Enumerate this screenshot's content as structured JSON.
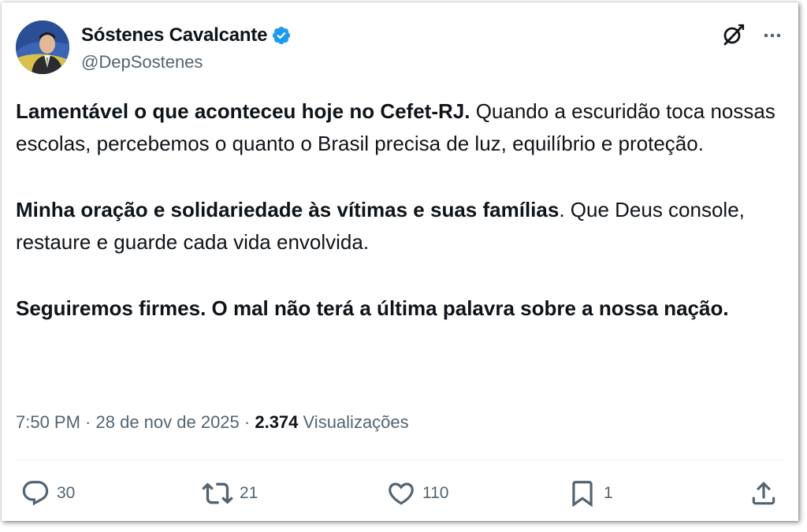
{
  "author": {
    "name": "Sóstenes Cavalcante",
    "handle": "@DepSostenes",
    "verified": true,
    "verified_color": "#1d9bf0"
  },
  "tweet": {
    "paragraphs": [
      {
        "bold": "Lamentável o que aconteceu hoje no Cefet-RJ.",
        "normal": " Quando a escuridão toca nossas escolas, percebemos o quanto o Brasil precisa de luz, equilíbrio e proteção."
      },
      {
        "bold": "Minha oração e solidariedade às vítimas e suas famílias",
        "normal": ". Que Deus console, restaure e guarde cada vida envolvida."
      },
      {
        "bold": "Seguiremos firmes. O mal não terá a última palavra sobre a nossa nação.",
        "normal": ""
      }
    ]
  },
  "meta": {
    "time": "7:50 PM",
    "separator": " · ",
    "date": "28 de nov de 2025",
    "views_count": "2.374",
    "views_label": "Visualizações"
  },
  "actions": {
    "replies": "30",
    "reposts": "21",
    "likes": "110",
    "bookmarks": "1"
  },
  "icons": {
    "grok": "grok-icon",
    "more": "more-icon",
    "reply": "reply-icon",
    "repost": "repost-icon",
    "like": "like-icon",
    "bookmark": "bookmark-icon",
    "share": "share-icon"
  },
  "colors": {
    "text": "#0f1419",
    "secondary": "#536471",
    "divider": "#eff3f4"
  }
}
